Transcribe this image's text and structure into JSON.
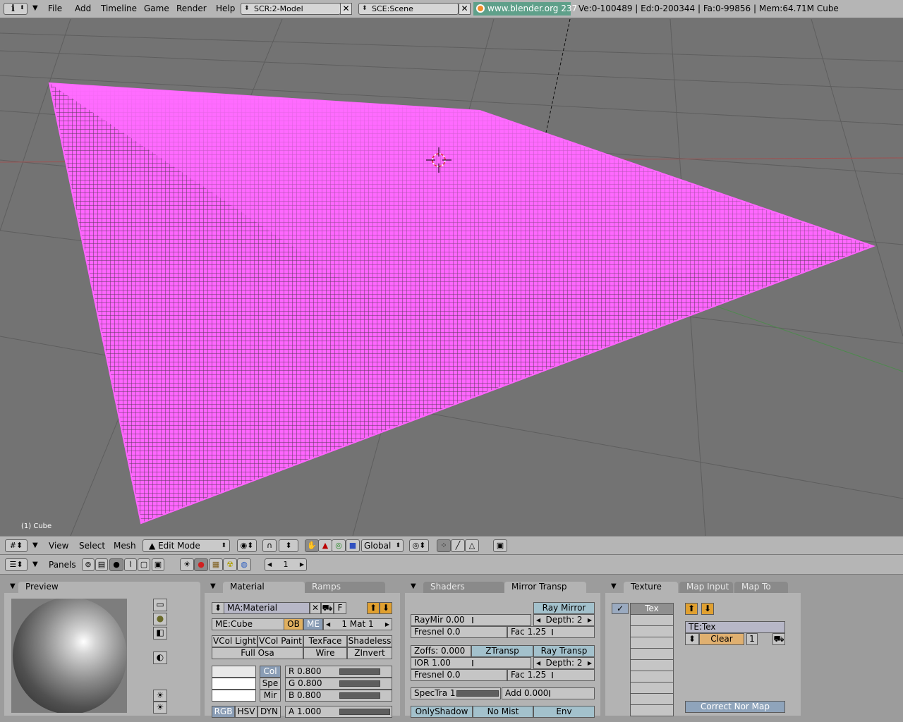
{
  "topbar": {
    "menus": [
      "File",
      "Add",
      "Timeline",
      "Game",
      "Render",
      "Help"
    ],
    "screen_combo": "SCR:2-Model",
    "scene_combo": "SCE:Scene",
    "version": "www.blender.org 237",
    "stats": "Ve:0-100489 | Ed:0-200344 | Fa:0-99856 | Mem:64.71M Cube"
  },
  "viewport": {
    "object_label": "(1) Cube",
    "colors": {
      "mesh": "#ff6cff",
      "background": "#737373",
      "grid": "#5f5f5f"
    }
  },
  "header3d": {
    "menus": [
      "View",
      "Select",
      "Mesh"
    ],
    "mode": "Edit Mode",
    "orientation": "Global"
  },
  "buttons_header": {
    "panels_label": "Panels",
    "frame": "1"
  },
  "preview": {
    "title": "Preview"
  },
  "material": {
    "tabs": [
      "Material",
      "Ramps"
    ],
    "ma_name": "MA:Material",
    "f_label": "F",
    "me_name": "ME:Cube",
    "ob_label": "OB",
    "me_label": "ME",
    "mat_index": "1 Mat 1",
    "toggles": [
      "VCol Light",
      "VCol Paint",
      "TexFace",
      "Shadeless"
    ],
    "toggles2": [
      "Full Osa",
      "Wire",
      "ZInvert"
    ],
    "color_types": [
      "Col",
      "Spe",
      "Mir"
    ],
    "sliders": [
      {
        "label": "R 0.800",
        "value": 0.8
      },
      {
        "label": "G 0.800",
        "value": 0.8
      },
      {
        "label": "B 0.800",
        "value": 0.8
      }
    ],
    "modes": [
      "RGB",
      "HSV",
      "DYN"
    ],
    "alpha": {
      "label": "A 1.000",
      "value": 1.0
    }
  },
  "shaders": {
    "tabs": [
      "Shaders",
      "Mirror Transp"
    ],
    "ray_mirror": "Ray Mirror",
    "raymir": "RayMir 0.00",
    "depth1": "Depth: 2",
    "fresnel1": "Fresnel 0.0",
    "fac1": "Fac 1.25",
    "zoffs": "Zoffs: 0.000",
    "ztransp": "ZTransp",
    "ray_transp": "Ray Transp",
    "ior": "IOR 1.00",
    "depth2": "Depth: 2",
    "fresnel2": "Fresnel 0.0",
    "fac2": "Fac 1.25",
    "spectra": "SpecTra 1.",
    "add": "Add 0.000",
    "bottom": [
      "OnlyShadow",
      "No Mist",
      "Env"
    ]
  },
  "texture": {
    "tabs": [
      "Texture",
      "Map Input",
      "Map To"
    ],
    "slot1": "Tex",
    "te_name": "TE:Tex",
    "clear": "Clear",
    "users": "1",
    "correct_nor": "Correct Nor Map"
  }
}
